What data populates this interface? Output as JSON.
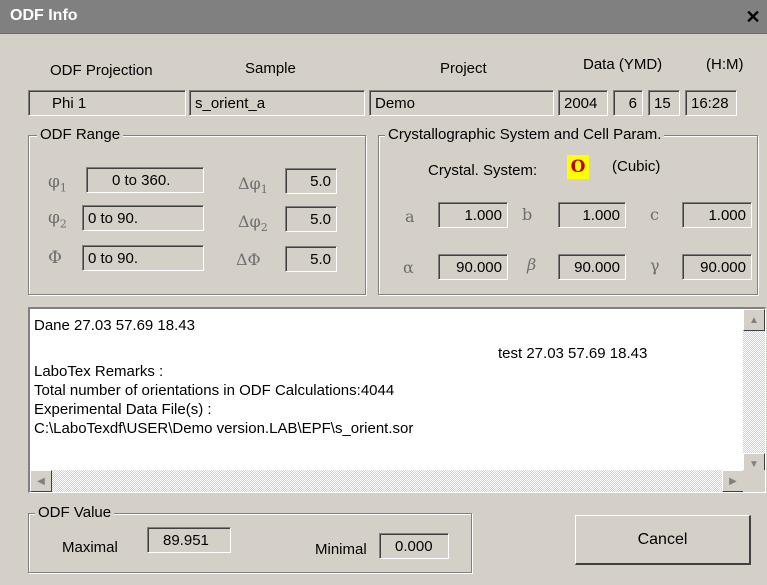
{
  "window": {
    "title": "ODF Info",
    "close_glyph": "✕"
  },
  "header": {
    "odf_projection_label": "ODF Projection",
    "sample_label": "Sample",
    "project_label": "Project",
    "date_label": "Data (YMD)",
    "time_label": "(H:M)",
    "odf_projection_value": "Phi 1",
    "sample_value": "s_orient_a",
    "project_value": "Demo",
    "year": "2004",
    "month": "6",
    "day": "15",
    "time": "16:28"
  },
  "odf_range": {
    "title": "ODF Range",
    "phi1_symbol": "φ",
    "phi1_sub": "1",
    "phi1_range": "0 to 360.",
    "phi2_symbol": "φ",
    "phi2_sub": "2",
    "phi2_range": "0 to 90.",
    "Phi_symbol": "Φ",
    "Phi_range": "0 to 90.",
    "dphi1_symbol": "Δφ",
    "dphi1_sub": "1",
    "dphi1_value": "5.0",
    "dphi2_symbol": "Δφ",
    "dphi2_sub": "2",
    "dphi2_value": "5.0",
    "dPhi_symbol": "ΔΦ",
    "dPhi_value": "5.0"
  },
  "crystal": {
    "title": "Crystallographic System and Cell Param.",
    "system_label": "Crystal. System:",
    "system_code": "O",
    "system_name": "(Cubic)",
    "a_label": "a",
    "a_value": "1.000",
    "b_label": "b",
    "b_value": "1.000",
    "c_label": "c",
    "c_value": "1.000",
    "alpha_label": "α",
    "alpha_value": "90.000",
    "beta_label": "β",
    "beta_value": "90.000",
    "gamma_label": "γ",
    "gamma_value": "90.000"
  },
  "remarks": {
    "line1": "Dane 27.03 57.69 18.43",
    "line1_right": "test  27.03 57.69 18.43",
    "line2": "LaboTex Remarks :",
    "line3": "Total number of orientations in ODF Calculations:4044",
    "line4": "Experimental Data File(s) :",
    "line5": "C:\\LaboTexdf\\USER\\Demo version.LAB\\EPF\\s_orient.sor"
  },
  "odf_value": {
    "title": "ODF Value",
    "maximal_label": "Maximal",
    "maximal_value": "89.951",
    "minimal_label": "Minimal",
    "minimal_value": "0.000"
  },
  "buttons": {
    "cancel_label": "Cancel"
  }
}
